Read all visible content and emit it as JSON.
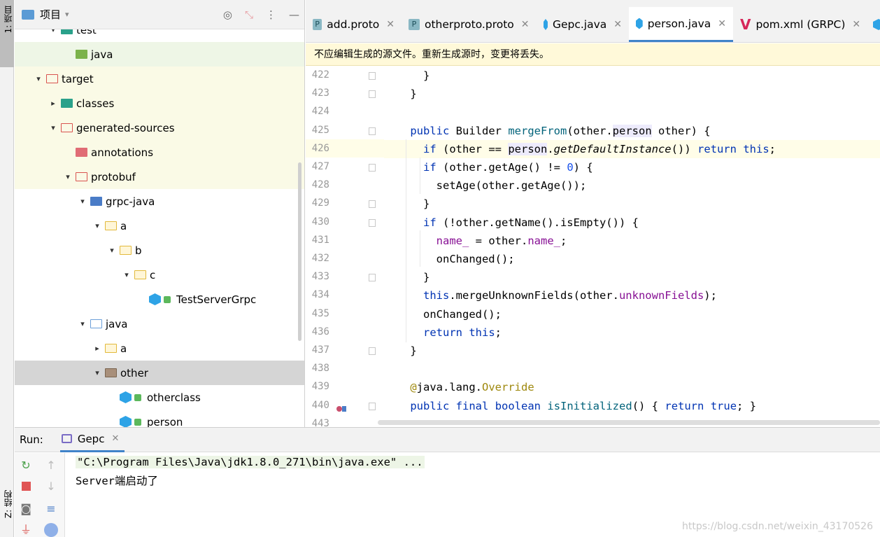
{
  "left_strip": {
    "project_label": "1: 项目",
    "structure_label": "Z: 结构"
  },
  "project_panel": {
    "title": "项目",
    "tree": [
      {
        "label": "test",
        "indent": 1,
        "arrow": "▾",
        "icon": "teal"
      },
      {
        "label": "java",
        "indent": 2,
        "arrow": "",
        "icon": "green"
      },
      {
        "label": "target",
        "indent": 0,
        "arrow": "▾",
        "icon": "red-outline"
      },
      {
        "label": "classes",
        "indent": 1,
        "arrow": "▸",
        "icon": "teal"
      },
      {
        "label": "generated-sources",
        "indent": 1,
        "arrow": "▾",
        "icon": "red-outline"
      },
      {
        "label": "annotations",
        "indent": 2,
        "arrow": "",
        "icon": "red"
      },
      {
        "label": "protobuf",
        "indent": 2,
        "arrow": "▾",
        "icon": "red-outline"
      },
      {
        "label": "grpc-java",
        "indent": 3,
        "arrow": "▾",
        "icon": "blue"
      },
      {
        "label": "a",
        "indent": 4,
        "arrow": "▾",
        "icon": "yellow-outline"
      },
      {
        "label": "b",
        "indent": 5,
        "arrow": "▾",
        "icon": "yellow-outline"
      },
      {
        "label": "c",
        "indent": 6,
        "arrow": "▾",
        "icon": "yellow-outline"
      },
      {
        "label": "TestServerGrpc",
        "indent": 7,
        "arrow": "",
        "icon": "class"
      },
      {
        "label": "java",
        "indent": 3,
        "arrow": "▾",
        "icon": "blue-outline"
      },
      {
        "label": "a",
        "indent": 4,
        "arrow": "▸",
        "icon": "yellow-outline"
      },
      {
        "label": "other",
        "indent": 4,
        "arrow": "▾",
        "icon": "brown"
      },
      {
        "label": "otherclass",
        "indent": 5,
        "arrow": "",
        "icon": "class"
      },
      {
        "label": "person",
        "indent": 5,
        "arrow": "",
        "icon": "class"
      }
    ]
  },
  "tabs": [
    {
      "label": "add.proto",
      "icon": "proto",
      "icon_text": "P"
    },
    {
      "label": "otherproto.proto",
      "icon": "proto",
      "icon_text": "P"
    },
    {
      "label": "Gepc.java",
      "icon": "java",
      "icon_text": ""
    },
    {
      "label": "person.java",
      "icon": "java",
      "icon_text": "",
      "active": true
    },
    {
      "label": "pom.xml (GRPC)",
      "icon": "maven",
      "icon_text": "V"
    }
  ],
  "warning": "不应编辑生成的源文件。重新生成源时，变更将丢失。",
  "editor": {
    "current_line": 426,
    "lines": [
      {
        "n": "422",
        "code": "      }"
      },
      {
        "n": "423",
        "code": "    }"
      },
      {
        "n": "424",
        "code": ""
      },
      {
        "n": "425",
        "code": "    public Builder mergeFrom(other.person other) {"
      },
      {
        "n": "426",
        "code": "      if (other == person.getDefaultInstance()) return this;"
      },
      {
        "n": "427",
        "code": "      if (other.getAge() != 0) {"
      },
      {
        "n": "428",
        "code": "        setAge(other.getAge());"
      },
      {
        "n": "429",
        "code": "      }"
      },
      {
        "n": "430",
        "code": "      if (!other.getName().isEmpty()) {"
      },
      {
        "n": "431",
        "code": "        name_ = other.name_;"
      },
      {
        "n": "432",
        "code": "        onChanged();"
      },
      {
        "n": "433",
        "code": "      }"
      },
      {
        "n": "434",
        "code": "      this.mergeUnknownFields(other.unknownFields);"
      },
      {
        "n": "435",
        "code": "      onChanged();"
      },
      {
        "n": "436",
        "code": "      return this;"
      },
      {
        "n": "437",
        "code": "    }"
      },
      {
        "n": "438",
        "code": ""
      },
      {
        "n": "439",
        "code": "    @java.lang.Override"
      },
      {
        "n": "440",
        "code": "    public final boolean isInitialized() { return true; }"
      },
      {
        "n": "443",
        "code": ""
      }
    ]
  },
  "run_panel": {
    "label": "Run:",
    "tab_label": "Gepc",
    "console_command": "\"C:\\Program Files\\Java\\jdk1.8.0_271\\bin\\java.exe\" ...",
    "console_output": "Server端启动了"
  },
  "watermark": "https://blog.csdn.net/weixin_43170526",
  "colors": {
    "keyword": "#0033b3",
    "field": "#871094",
    "method": "#00627a",
    "number": "#1750eb",
    "annotation": "#9e880d",
    "accent": "#4083c9",
    "warning_bg": "#fff9d9"
  }
}
